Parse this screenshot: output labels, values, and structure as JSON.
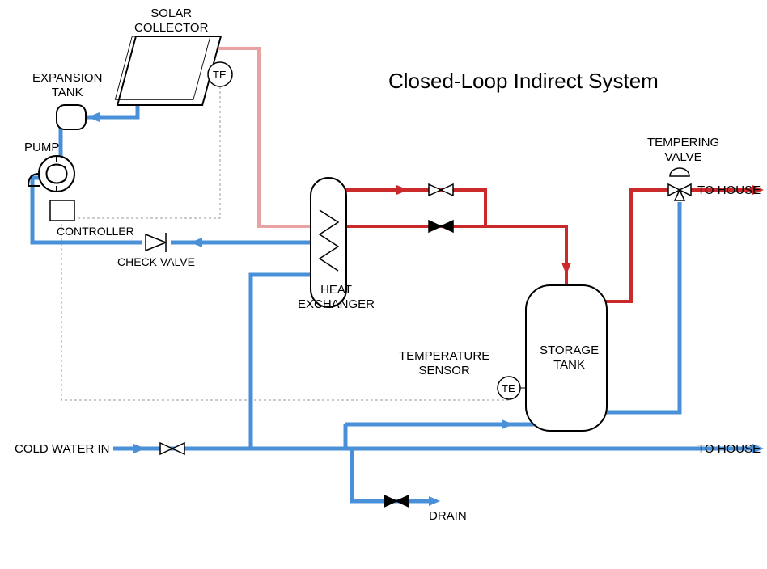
{
  "title": "Closed-Loop Indirect System",
  "labels": {
    "solar_collector": "SOLAR\nCOLLECTOR",
    "expansion_tank": "EXPANSION\nTANK",
    "pump": "PUMP",
    "controller": "CONTROLLER",
    "check_valve": "CHECK VALVE",
    "heat_exchanger": "HEAT\nEXCHANGER",
    "temperature_sensor": "TEMPERATURE\nSENSOR",
    "storage_tank": "STORAGE\nTANK",
    "tempering_valve": "TEMPERING\nVALVE",
    "te": "TE",
    "te2": "TE",
    "cold_water_in": "COLD WATER IN",
    "to_house": "TO HOUSE",
    "to_house2": "TO HOUSE",
    "drain": "DRAIN"
  },
  "colors": {
    "cold": "#4a90d9",
    "hot": "#cc2a2a",
    "warm": "#e9a2a2",
    "signal": "#888888"
  }
}
